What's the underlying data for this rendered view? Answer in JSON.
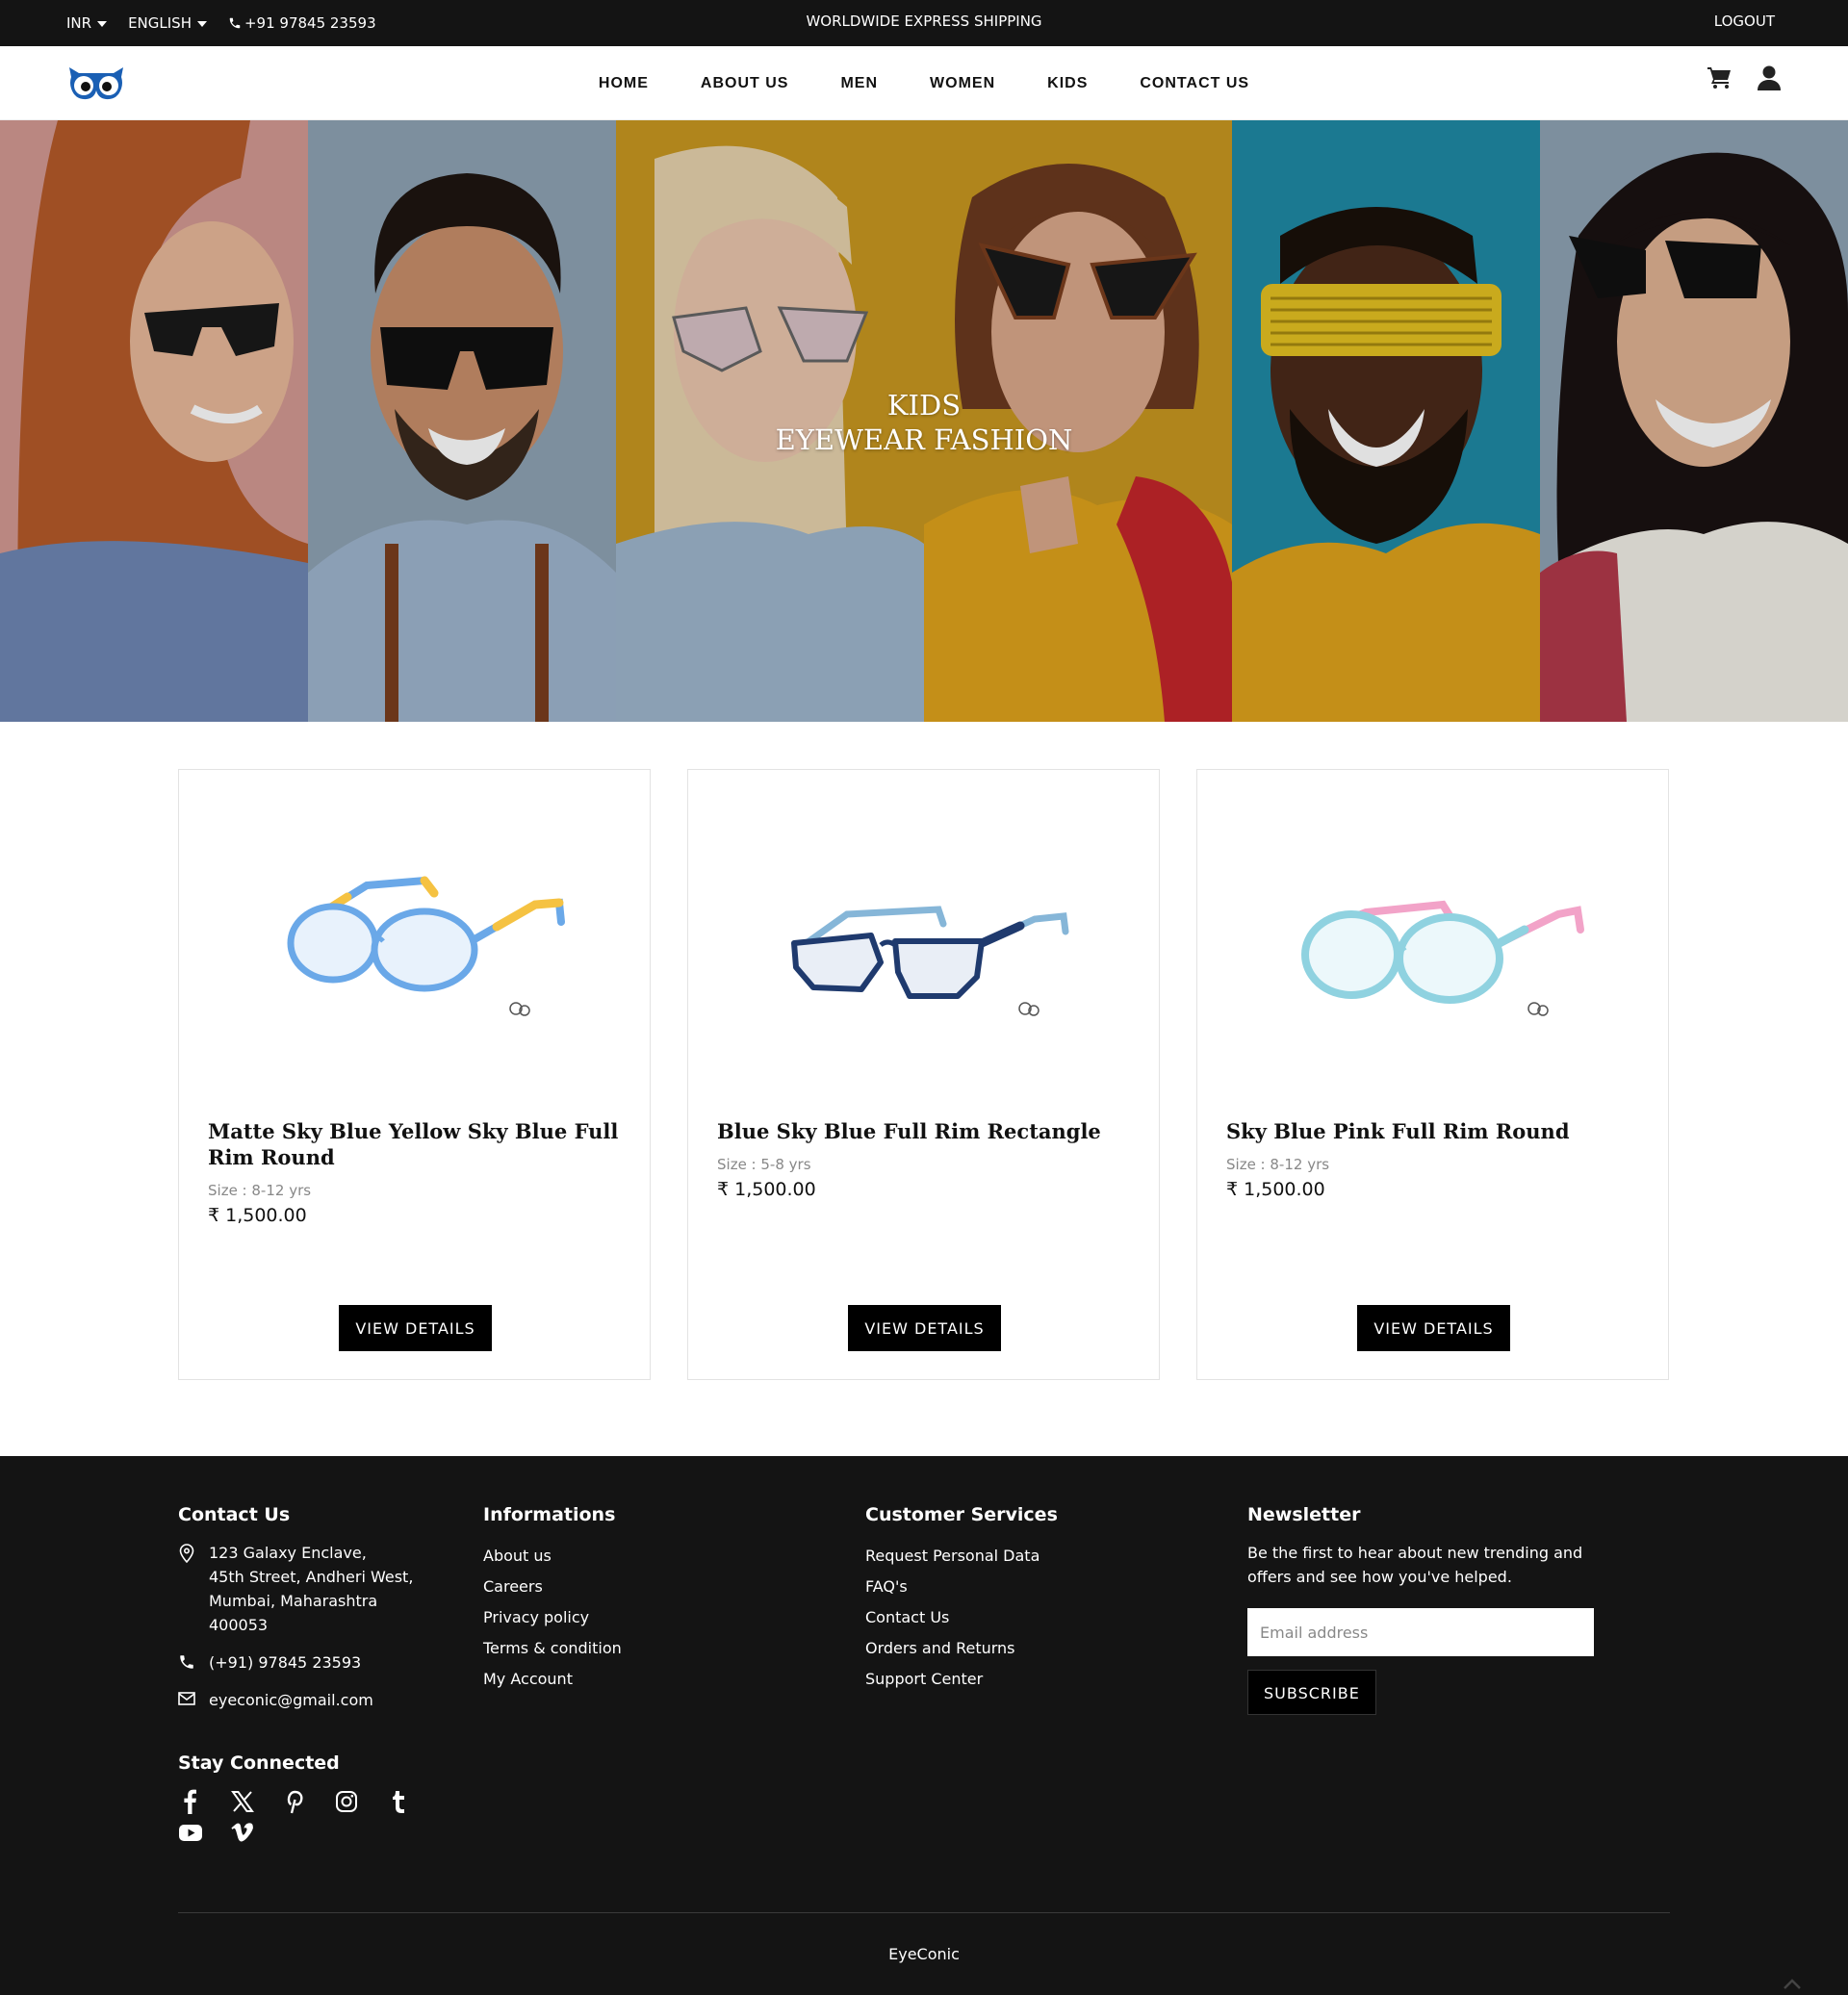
{
  "topbar": {
    "currency": "INR",
    "language": "ENGLISH",
    "phone": "+91 97845 23593",
    "announcement": "WORLDWIDE EXPRESS SHIPPING",
    "logout": "LOGOUT"
  },
  "nav": {
    "items": [
      "HOME",
      "ABOUT US",
      "MEN",
      "WOMEN",
      "KIDS",
      "CONTACT US"
    ],
    "icons": [
      "cart-icon",
      "user-icon"
    ],
    "logo_color": "#1a5fb4"
  },
  "hero": {
    "line1": "KIDS",
    "line2": "EYEWEAR FASHION",
    "panel_colors": [
      "#d49a93",
      "#8fa3b4",
      "#c99820",
      "#c99820",
      "#1f8aa5",
      "#8fa3b4"
    ]
  },
  "products": [
    {
      "name": "Matte Sky Blue Yellow Sky Blue Full Rim Round",
      "size": "Size : 8-12 yrs",
      "price": "₹ 1,500.00",
      "button": "VIEW DETAILS",
      "frame_color": "#6aa8e8",
      "temple_color": "#f5c242"
    },
    {
      "name": "Blue Sky Blue Full Rim Rectangle",
      "size": "Size : 5-8 yrs",
      "price": "₹ 1,500.00",
      "button": "VIEW DETAILS",
      "frame_color": "#1f3a6e",
      "temple_color": "#86b6d8"
    },
    {
      "name": "Sky Blue Pink Full Rim Round",
      "size": "Size : 8-12 yrs",
      "price": "₹ 1,500.00",
      "button": "VIEW DETAILS",
      "frame_color": "#8fd2e0",
      "temple_color": "#f2a3c8"
    }
  ],
  "footer": {
    "contact": {
      "title": "Contact Us",
      "address": "123 Galaxy Enclave,\n45th Street, Andheri West,\nMumbai, Maharashtra\n400053",
      "phone": "(+91) 97845 23593",
      "email": "eyeconic@gmail.com"
    },
    "informations": {
      "title": "Informations",
      "links": [
        "About us",
        "Careers",
        "Privacy policy",
        "Terms & condition",
        "My Account"
      ]
    },
    "customer_services": {
      "title": "Customer Services",
      "links": [
        "Request Personal Data",
        "FAQ's",
        "Contact Us",
        "Orders and Returns",
        "Support Center"
      ]
    },
    "newsletter": {
      "title": "Newsletter",
      "text": "Be the first to hear about new trending and offers and see how you've helped.",
      "placeholder": "Email address",
      "button": "SUBSCRIBE"
    },
    "stay_connected": {
      "title": "Stay Connected",
      "icons": [
        "facebook-icon",
        "x-icon",
        "pinterest-icon",
        "instagram-icon",
        "tumblr-icon",
        "youtube-icon",
        "vimeo-icon"
      ]
    },
    "copyright": "EyeConic"
  }
}
